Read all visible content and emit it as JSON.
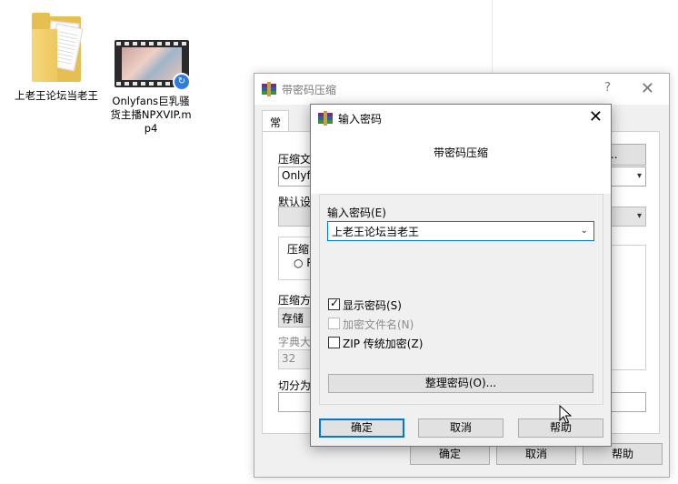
{
  "desktop": {
    "icons": [
      {
        "label": "上老王论坛当老王",
        "icon": "folder-icon"
      },
      {
        "label": "Onlyfans巨乳骚货主播NPXVIP.mp4",
        "icon": "video-file-icon"
      }
    ]
  },
  "back_window": {
    "title": "带密码压缩",
    "help_glyph": "?",
    "close_glyph": "✕",
    "tabs": [
      "常规"
    ],
    "labels": {
      "archive_name": "压缩文",
      "default_profile": "默认设",
      "archive_format": "压缩",
      "compression_method": "压缩方",
      "dictionary_size": "字典大",
      "split_volumes": "切分为"
    },
    "archive_name_value": "Onlyfa",
    "browse_button": "(B)...",
    "radio_partial": "R",
    "method_value": "存储",
    "dictionary_value": "32",
    "buttons": {
      "ok": "确定",
      "cancel": "取消",
      "help": "帮助"
    }
  },
  "password_dialog": {
    "title": "输入密码",
    "close_glyph": "✕",
    "heading": "带密码压缩",
    "password_label": "输入密码(E)",
    "password_value": "上老王论坛当老王",
    "options": [
      {
        "label": "显示密码(S)",
        "checked": true,
        "enabled": true
      },
      {
        "label": "加密文件名(N)",
        "checked": false,
        "enabled": false
      },
      {
        "label": "ZIP 传统加密(Z)",
        "checked": false,
        "enabled": true
      }
    ],
    "organize_button": "整理密码(O)...",
    "buttons": {
      "ok": "确定",
      "cancel": "取消",
      "help": "帮助"
    }
  }
}
